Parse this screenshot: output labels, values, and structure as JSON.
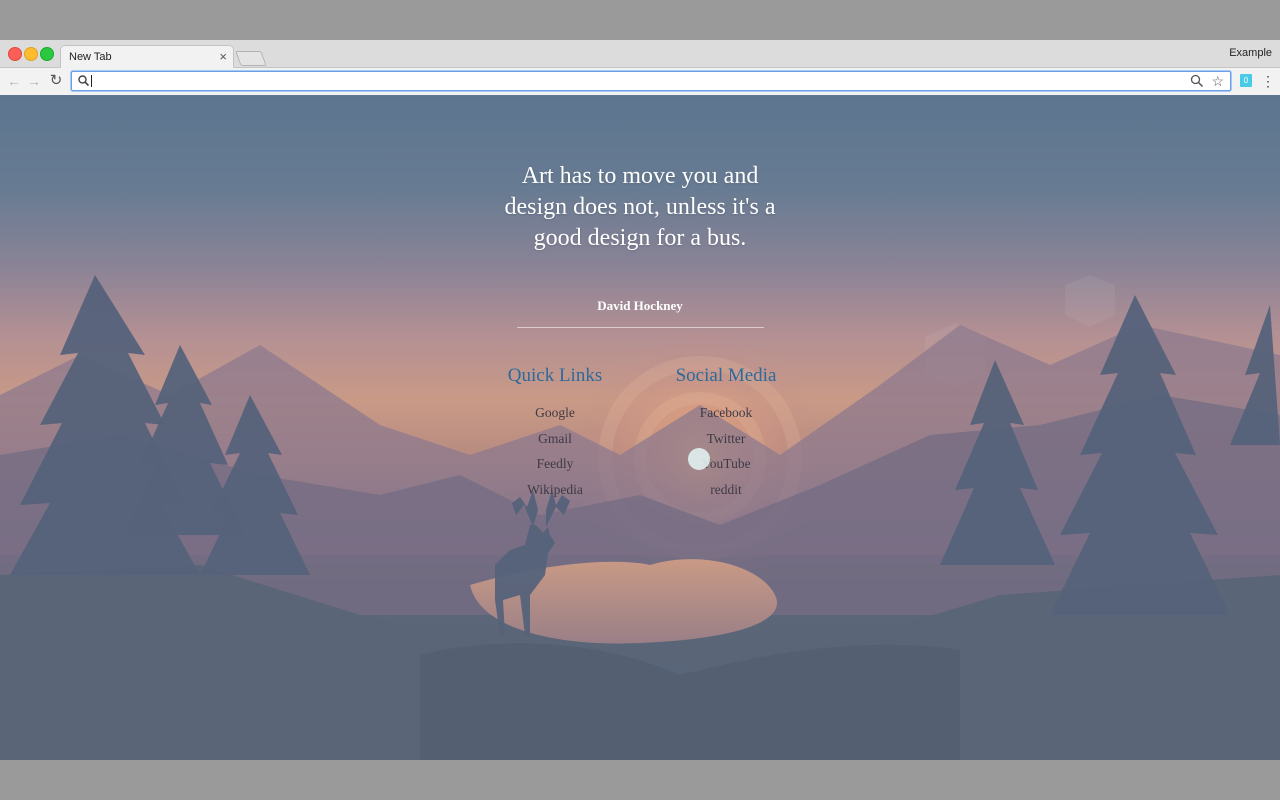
{
  "window": {
    "tab_title": "New Tab",
    "tab_close": "×",
    "profile_name": "Example"
  },
  "toolbar": {
    "back": "←",
    "forward": "→",
    "reload": "↻",
    "omnibox_value": "",
    "star": "☆",
    "extension_badge": "0",
    "menu": "⋮"
  },
  "quote": {
    "text": "Art has to move you and design does not, unless it's a good design for a bus.",
    "author": "David Hockney"
  },
  "quick_links": {
    "heading": "Quick Links",
    "items": [
      "Google",
      "Gmail",
      "Feedly",
      "Wikipedia"
    ]
  },
  "social_media": {
    "heading": "Social Media",
    "items": [
      "Facebook",
      "Twitter",
      "YouTube",
      "reddit"
    ]
  },
  "colors": {
    "heading_color": "#2d6a9c",
    "omnibox_focus": "#6aa0e8",
    "traffic_close": "#fc5f57",
    "traffic_min": "#fdbc2e",
    "traffic_max": "#29c840"
  }
}
